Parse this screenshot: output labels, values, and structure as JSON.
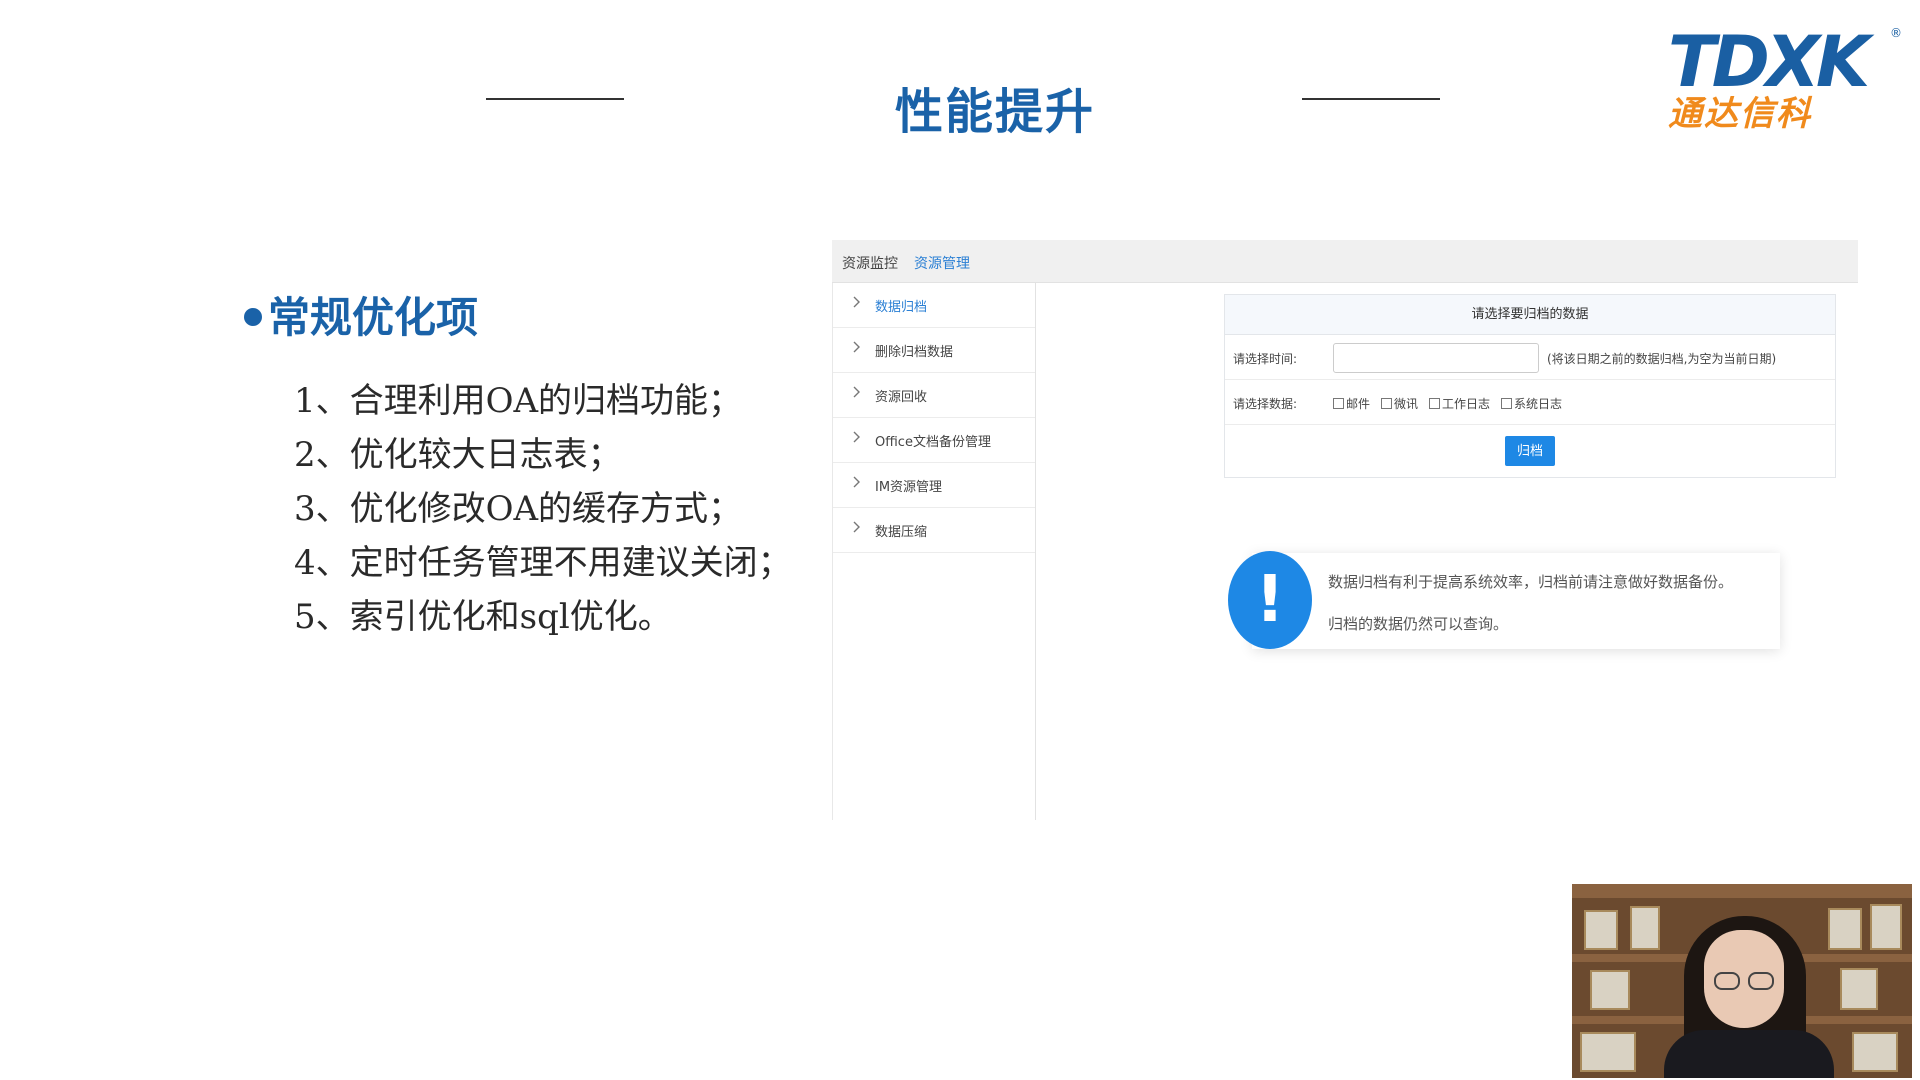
{
  "slide": {
    "title": "性能提升"
  },
  "logo": {
    "mark": "TDXK",
    "registered": "®",
    "name": "通达信科"
  },
  "section": {
    "heading": "常规优化项",
    "points": [
      "1、合理利用OA的归档功能；",
      "2、优化较大日志表；",
      "3、优化修改OA的缓存方式；",
      "4、定时任务管理不用建议关闭；",
      "5、索引优化和sql优化。"
    ]
  },
  "screenshot": {
    "tabs": [
      "资源监控",
      "资源管理"
    ],
    "sidebar": [
      {
        "label": "数据归档",
        "active": true
      },
      {
        "label": "删除归档数据",
        "active": false
      },
      {
        "label": "资源回收",
        "active": false
      },
      {
        "label": "Office文档备份管理",
        "active": false
      },
      {
        "label": "IM资源管理",
        "active": false
      },
      {
        "label": "数据压缩",
        "active": false
      }
    ],
    "form": {
      "header": "请选择要归档的数据",
      "time_label": "请选择时间:",
      "time_value": "",
      "time_hint": "(将该日期之前的数据归档,为空为当前日期)",
      "data_label": "请选择数据:",
      "options": [
        "邮件",
        "微讯",
        "工作日志",
        "系统日志"
      ],
      "submit_label": "归档"
    },
    "notice": {
      "icon": "exclamation-icon",
      "line1": "数据归档有利于提高系统效率，归档前请注意做好数据备份。",
      "line2": "归档的数据仍然可以查询。"
    }
  },
  "colors": {
    "title_blue": "#1a62a8",
    "logo_orange": "#f08a1c",
    "accent_blue": "#1e88e5"
  }
}
